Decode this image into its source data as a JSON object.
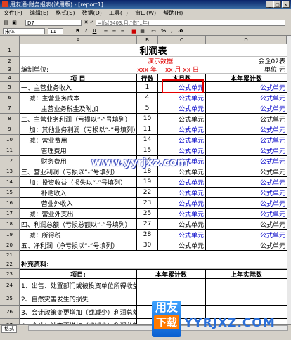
{
  "window": {
    "title": "用友通-财务报表(试用版) - [report1]"
  },
  "menu": [
    "文件(F)",
    "编辑(E)",
    "格式(S)",
    "数据(D)",
    "工具(T)",
    "窗口(W)",
    "帮助(H)"
  ],
  "formula_bar": {
    "cell_ref": "D7",
    "formula": "=lfs(5403,月,\"借\",,年)"
  },
  "toolbar": {
    "font": "宋体",
    "size": "11",
    "bold": "B",
    "italic": "I",
    "underline": "U"
  },
  "columns": [
    "A",
    "B",
    "C",
    "D"
  ],
  "sheet": {
    "title": "利润表",
    "demo_label": "演示数据",
    "form_code": "会企02表",
    "unit_label": "编制单位:",
    "date_year": "xxxx 年",
    "date_month_day": "xx 月 xx 日",
    "currency_unit": "单位:元",
    "header": {
      "item": "项          目",
      "line_no": "行数",
      "this_month": "本月数",
      "ytd": "本年累计数"
    },
    "formula_text": "公式单元",
    "rows": [
      {
        "n": "5",
        "item": "一、主营业务收入",
        "line": "1",
        "c_blue": true,
        "d_blue": true
      },
      {
        "n": "6",
        "item": "    减：主营业务成本",
        "line": "4",
        "c_blue": true,
        "d_blue": true
      },
      {
        "n": "7",
        "item": "          主营业务税金及附加",
        "line": "5",
        "c_blue": true,
        "d_blue": true
      },
      {
        "n": "8",
        "item": "二、主营业务利润（亏损以“-”号填列）",
        "line": "10",
        "c_blue": false,
        "d_blue": false
      },
      {
        "n": "9",
        "item": "    加：其他业务利润（亏损以“-”号填列）",
        "line": "11",
        "c_blue": true,
        "d_blue": true
      },
      {
        "n": "10",
        "item": "    减：营业费用",
        "line": "14",
        "c_blue": true,
        "d_blue": true
      },
      {
        "n": "11",
        "item": "          管理费用",
        "line": "15",
        "c_blue": true,
        "d_blue": true
      },
      {
        "n": "12",
        "item": "          财务费用",
        "line": "16",
        "c_blue": true,
        "d_blue": true
      },
      {
        "n": "13",
        "item": "三、营业利润（亏损以“-”号填列）",
        "line": "18",
        "c_blue": false,
        "d_blue": false
      },
      {
        "n": "14",
        "item": "    加：投资收益（损失以“-”号填列）",
        "line": "19",
        "c_blue": true,
        "d_blue": true
      },
      {
        "n": "15",
        "item": "          补贴收入",
        "line": "22",
        "c_blue": true,
        "d_blue": true
      },
      {
        "n": "16",
        "item": "          营业外收入",
        "line": "23",
        "c_blue": true,
        "d_blue": true
      },
      {
        "n": "17",
        "item": "    减：营业外支出",
        "line": "25",
        "c_blue": true,
        "d_blue": true
      },
      {
        "n": "18",
        "item": "四、利润总额（亏损总额以“-”号填列）",
        "line": "27",
        "c_blue": false,
        "d_blue": false
      },
      {
        "n": "19",
        "item": "    减：所得税",
        "line": "28",
        "c_blue": true,
        "d_blue": true
      },
      {
        "n": "20",
        "item": "五、净利润（净亏损以“-”号填列）",
        "line": "30",
        "c_blue": false,
        "d_blue": false
      }
    ],
    "supplement_title": "补充资料:",
    "supp_header": {
      "item": "项目:",
      "ytd": "本年累计数",
      "prev": "上年实际数"
    },
    "supp_rows": [
      {
        "n": "24",
        "item": "1、出售、处置部门或被投资单位所得收益"
      },
      {
        "n": "25",
        "item": "2、自然灾害发生的损失"
      },
      {
        "n": "26",
        "item": "3、会计政策变更增加（或减少）利润总额"
      },
      {
        "n": "27",
        "item": "4、会计估计变更增加（或减少）利润总额"
      }
    ],
    "tab": "格式"
  },
  "watermark": {
    "url": "www.yyrjxz.com",
    "logo_top": "用友",
    "logo_bottom": "下载",
    "brand": "YYRJXZ.COM"
  },
  "colors": {
    "blue_text": "#0000c8",
    "red_text": "#e00000",
    "chrome": "#d4d0c8"
  }
}
